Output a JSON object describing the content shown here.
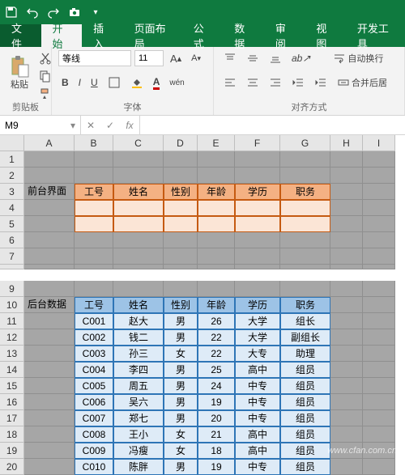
{
  "quickAccess": {
    "save": "💾"
  },
  "tabs": {
    "file": "文件",
    "home": "开始",
    "insert": "插入",
    "pageLayout": "页面布局",
    "formulas": "公式",
    "data": "数据",
    "review": "审阅",
    "view": "视图",
    "dev": "开发工具"
  },
  "ribbon": {
    "paste": "粘贴",
    "clipboard": "剪贴板",
    "fontName": "等线",
    "fontSize": "11",
    "fontGroup": "字体",
    "alignGroup": "对齐方式",
    "wrap": "自动换行",
    "merge": "合并后居"
  },
  "nameBox": "M9",
  "cols": [
    "A",
    "B",
    "C",
    "D",
    "E",
    "F",
    "G",
    "H",
    "I"
  ],
  "rows": [
    "1",
    "2",
    "3",
    "4",
    "5",
    "6",
    "7",
    "8",
    "9",
    "10",
    "11",
    "12",
    "13",
    "14",
    "15",
    "16",
    "17",
    "18",
    "19",
    "20"
  ],
  "labels": {
    "front": "前台界面",
    "back": "后台数据"
  },
  "headers": [
    "工号",
    "姓名",
    "性别",
    "年龄",
    "学历",
    "职务"
  ],
  "chart_data": {
    "type": "table",
    "title": "后台数据",
    "columns": [
      "工号",
      "姓名",
      "性别",
      "年龄",
      "学历",
      "职务"
    ],
    "rows": [
      [
        "C001",
        "赵大",
        "男",
        "26",
        "大学",
        "组长"
      ],
      [
        "C002",
        "钱二",
        "男",
        "22",
        "大学",
        "副组长"
      ],
      [
        "C003",
        "孙三",
        "女",
        "22",
        "大专",
        "助理"
      ],
      [
        "C004",
        "李四",
        "男",
        "25",
        "高中",
        "组员"
      ],
      [
        "C005",
        "周五",
        "男",
        "24",
        "中专",
        "组员"
      ],
      [
        "C006",
        "吴六",
        "男",
        "19",
        "中专",
        "组员"
      ],
      [
        "C007",
        "郑七",
        "男",
        "20",
        "中专",
        "组员"
      ],
      [
        "C008",
        "王小",
        "女",
        "21",
        "高中",
        "组员"
      ],
      [
        "C009",
        "冯瘦",
        "女",
        "18",
        "高中",
        "组员"
      ],
      [
        "C010",
        "陈胖",
        "男",
        "19",
        "中专",
        "组员"
      ]
    ]
  },
  "watermark": "www.cfan.com.cn"
}
